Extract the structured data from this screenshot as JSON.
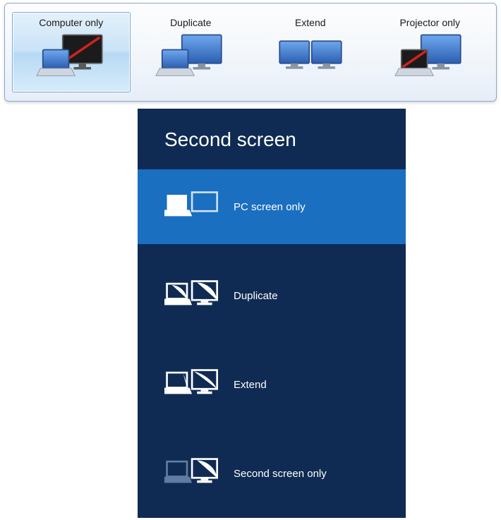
{
  "win7": {
    "options": [
      {
        "label": "Computer only",
        "selected": true
      },
      {
        "label": "Duplicate",
        "selected": false
      },
      {
        "label": "Extend",
        "selected": false
      },
      {
        "label": "Projector only",
        "selected": false
      }
    ]
  },
  "win8": {
    "title": "Second screen",
    "options": [
      {
        "label": "PC screen only",
        "selected": true
      },
      {
        "label": "Duplicate",
        "selected": false
      },
      {
        "label": "Extend",
        "selected": false
      },
      {
        "label": "Second screen only",
        "selected": false
      }
    ]
  }
}
